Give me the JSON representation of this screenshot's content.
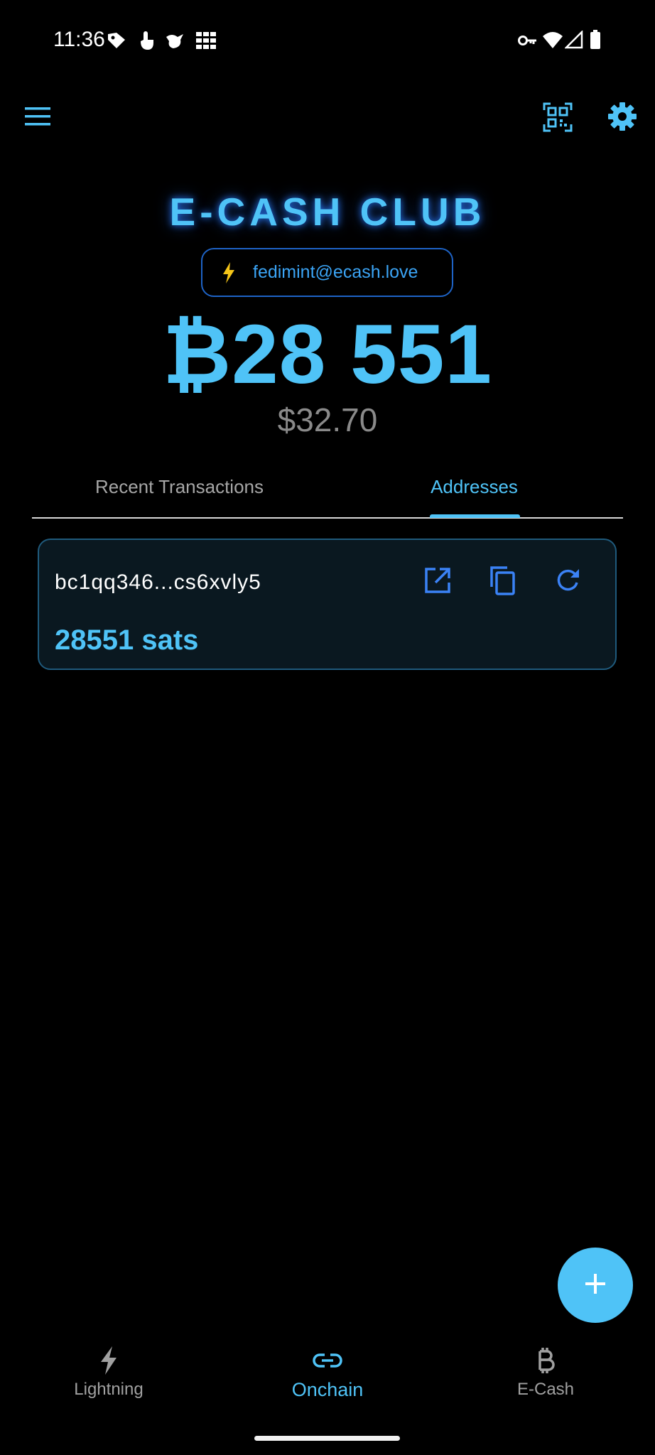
{
  "status_bar": {
    "time": "11:36",
    "left_icons": [
      "tag-icon",
      "touch-icon",
      "bird-icon",
      "grid-icon"
    ],
    "right_icons": [
      "key-icon",
      "wifi-icon",
      "signal-icon",
      "battery-icon"
    ]
  },
  "app_bar": {
    "icons": [
      "menu-icon",
      "qr-scan-icon",
      "gear-icon"
    ]
  },
  "header": {
    "club_name": "E-CASH CLUB",
    "lightning_address": "fedimint@ecash.love",
    "balance": "₿28 551",
    "fiat_balance": "$32.70"
  },
  "tabs": [
    {
      "label": "Recent Transactions",
      "selected": false
    },
    {
      "label": "Addresses",
      "selected": true
    }
  ],
  "addresses": [
    {
      "address": "bc1qq346...cs6xvly5",
      "amount": "28551 sats",
      "actions": [
        "open-external-icon",
        "copy-icon",
        "refresh-icon"
      ]
    }
  ],
  "fab": {
    "icon": "plus-icon"
  },
  "bottom_nav": [
    {
      "label": "Lightning",
      "icon": "lightning-icon",
      "selected": false
    },
    {
      "label": "Onchain",
      "icon": "link-icon",
      "selected": true
    },
    {
      "label": "E-Cash",
      "icon": "bitcoin-icon",
      "selected": false
    }
  ],
  "colors": {
    "accent": "#4fc3f7",
    "background": "#000000",
    "card_background": "#0a1820",
    "card_border": "#1f5a7c",
    "lightning_yellow": "#f5c518",
    "muted_text": "#a6a6a6"
  }
}
